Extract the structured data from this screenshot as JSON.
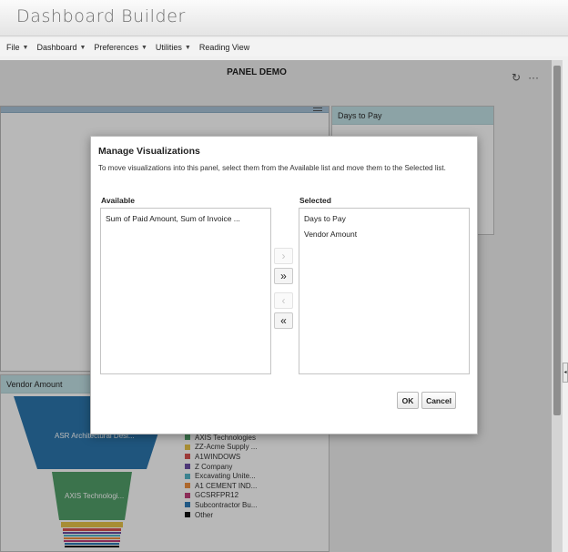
{
  "app": {
    "title": "Dashboard Builder"
  },
  "menubar": {
    "items": [
      {
        "label": "File",
        "caret": "▼"
      },
      {
        "label": "Dashboard",
        "caret": "▼"
      },
      {
        "label": "Preferences",
        "caret": "▼"
      },
      {
        "label": "Utilities",
        "caret": "▼"
      },
      {
        "label": "Reading View",
        "caret": ""
      }
    ]
  },
  "panel": {
    "title": "PANEL DEMO",
    "refresh_icon": "refresh-icon",
    "more_icon": "more-options-icon"
  },
  "days_to_pay": {
    "title": "Days to Pay"
  },
  "vendor_amount": {
    "title": "Vendor Amount",
    "funnel_labels": [
      "ASR Architectural Desi...",
      "AXIS Technologi..."
    ],
    "legend": [
      {
        "label": "AXIS Technologies",
        "color": "#52a06a"
      },
      {
        "label": "ZZ-Acme Supply ...",
        "color": "#e8c44a"
      },
      {
        "label": "A1WINDOWS",
        "color": "#d9534f"
      },
      {
        "label": "Z Company",
        "color": "#6d4ea5"
      },
      {
        "label": "Excavating Unite...",
        "color": "#55b6c8"
      },
      {
        "label": "A1 CEMENT IND...",
        "color": "#f0913f"
      },
      {
        "label": "GCSRFPR12",
        "color": "#c13f7a"
      },
      {
        "label": "Subcontractor Bu...",
        "color": "#2f7ab8"
      },
      {
        "label": "Other",
        "color": "#111111"
      }
    ]
  },
  "dialog": {
    "title": "Manage Visualizations",
    "instructions": "To move visualizations into this panel, select them from the Available list and move them to the Selected list.",
    "available_label": "Available",
    "selected_label": "Selected",
    "available_items": [
      "Sum of Paid Amount, Sum of Invoice ..."
    ],
    "selected_items": [
      "Days to Pay",
      "Vendor Amount"
    ],
    "move_buttons": {
      "move_one_right": "›",
      "move_all_right": "»",
      "move_one_left": "‹",
      "move_all_left": "«"
    },
    "ok_label": "OK",
    "cancel_label": "Cancel"
  },
  "colors": {
    "panel_header": "#c3e2e6",
    "funnel_blue": "#2b77ad",
    "funnel_green": "#52a06a",
    "donut_green": "#2fbf7d",
    "donut_red": "#d9534f"
  }
}
